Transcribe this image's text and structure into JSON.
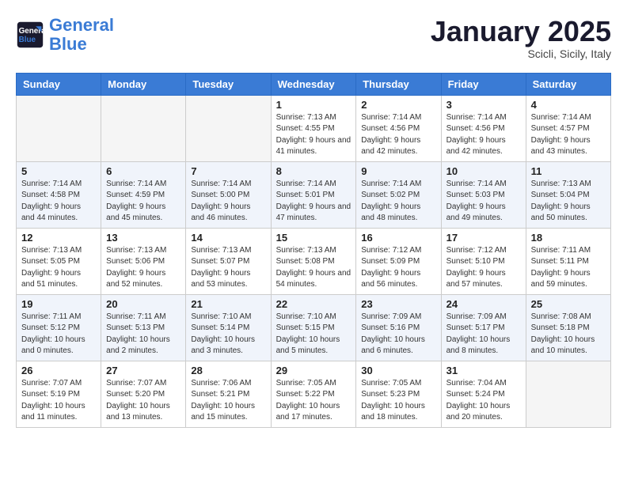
{
  "header": {
    "logo_line1": "General",
    "logo_line2": "Blue",
    "month_title": "January 2025",
    "location": "Scicli, Sicily, Italy"
  },
  "weekdays": [
    "Sunday",
    "Monday",
    "Tuesday",
    "Wednesday",
    "Thursday",
    "Friday",
    "Saturday"
  ],
  "weeks": [
    {
      "days": [
        {
          "num": "",
          "info": ""
        },
        {
          "num": "",
          "info": ""
        },
        {
          "num": "",
          "info": ""
        },
        {
          "num": "1",
          "info": "Sunrise: 7:13 AM\nSunset: 4:55 PM\nDaylight: 9 hours and 41 minutes."
        },
        {
          "num": "2",
          "info": "Sunrise: 7:14 AM\nSunset: 4:56 PM\nDaylight: 9 hours and 42 minutes."
        },
        {
          "num": "3",
          "info": "Sunrise: 7:14 AM\nSunset: 4:56 PM\nDaylight: 9 hours and 42 minutes."
        },
        {
          "num": "4",
          "info": "Sunrise: 7:14 AM\nSunset: 4:57 PM\nDaylight: 9 hours and 43 minutes."
        }
      ]
    },
    {
      "days": [
        {
          "num": "5",
          "info": "Sunrise: 7:14 AM\nSunset: 4:58 PM\nDaylight: 9 hours and 44 minutes."
        },
        {
          "num": "6",
          "info": "Sunrise: 7:14 AM\nSunset: 4:59 PM\nDaylight: 9 hours and 45 minutes."
        },
        {
          "num": "7",
          "info": "Sunrise: 7:14 AM\nSunset: 5:00 PM\nDaylight: 9 hours and 46 minutes."
        },
        {
          "num": "8",
          "info": "Sunrise: 7:14 AM\nSunset: 5:01 PM\nDaylight: 9 hours and 47 minutes."
        },
        {
          "num": "9",
          "info": "Sunrise: 7:14 AM\nSunset: 5:02 PM\nDaylight: 9 hours and 48 minutes."
        },
        {
          "num": "10",
          "info": "Sunrise: 7:14 AM\nSunset: 5:03 PM\nDaylight: 9 hours and 49 minutes."
        },
        {
          "num": "11",
          "info": "Sunrise: 7:13 AM\nSunset: 5:04 PM\nDaylight: 9 hours and 50 minutes."
        }
      ]
    },
    {
      "days": [
        {
          "num": "12",
          "info": "Sunrise: 7:13 AM\nSunset: 5:05 PM\nDaylight: 9 hours and 51 minutes."
        },
        {
          "num": "13",
          "info": "Sunrise: 7:13 AM\nSunset: 5:06 PM\nDaylight: 9 hours and 52 minutes."
        },
        {
          "num": "14",
          "info": "Sunrise: 7:13 AM\nSunset: 5:07 PM\nDaylight: 9 hours and 53 minutes."
        },
        {
          "num": "15",
          "info": "Sunrise: 7:13 AM\nSunset: 5:08 PM\nDaylight: 9 hours and 54 minutes."
        },
        {
          "num": "16",
          "info": "Sunrise: 7:12 AM\nSunset: 5:09 PM\nDaylight: 9 hours and 56 minutes."
        },
        {
          "num": "17",
          "info": "Sunrise: 7:12 AM\nSunset: 5:10 PM\nDaylight: 9 hours and 57 minutes."
        },
        {
          "num": "18",
          "info": "Sunrise: 7:11 AM\nSunset: 5:11 PM\nDaylight: 9 hours and 59 minutes."
        }
      ]
    },
    {
      "days": [
        {
          "num": "19",
          "info": "Sunrise: 7:11 AM\nSunset: 5:12 PM\nDaylight: 10 hours and 0 minutes."
        },
        {
          "num": "20",
          "info": "Sunrise: 7:11 AM\nSunset: 5:13 PM\nDaylight: 10 hours and 2 minutes."
        },
        {
          "num": "21",
          "info": "Sunrise: 7:10 AM\nSunset: 5:14 PM\nDaylight: 10 hours and 3 minutes."
        },
        {
          "num": "22",
          "info": "Sunrise: 7:10 AM\nSunset: 5:15 PM\nDaylight: 10 hours and 5 minutes."
        },
        {
          "num": "23",
          "info": "Sunrise: 7:09 AM\nSunset: 5:16 PM\nDaylight: 10 hours and 6 minutes."
        },
        {
          "num": "24",
          "info": "Sunrise: 7:09 AM\nSunset: 5:17 PM\nDaylight: 10 hours and 8 minutes."
        },
        {
          "num": "25",
          "info": "Sunrise: 7:08 AM\nSunset: 5:18 PM\nDaylight: 10 hours and 10 minutes."
        }
      ]
    },
    {
      "days": [
        {
          "num": "26",
          "info": "Sunrise: 7:07 AM\nSunset: 5:19 PM\nDaylight: 10 hours and 11 minutes."
        },
        {
          "num": "27",
          "info": "Sunrise: 7:07 AM\nSunset: 5:20 PM\nDaylight: 10 hours and 13 minutes."
        },
        {
          "num": "28",
          "info": "Sunrise: 7:06 AM\nSunset: 5:21 PM\nDaylight: 10 hours and 15 minutes."
        },
        {
          "num": "29",
          "info": "Sunrise: 7:05 AM\nSunset: 5:22 PM\nDaylight: 10 hours and 17 minutes."
        },
        {
          "num": "30",
          "info": "Sunrise: 7:05 AM\nSunset: 5:23 PM\nDaylight: 10 hours and 18 minutes."
        },
        {
          "num": "31",
          "info": "Sunrise: 7:04 AM\nSunset: 5:24 PM\nDaylight: 10 hours and 20 minutes."
        },
        {
          "num": "",
          "info": ""
        }
      ]
    }
  ]
}
